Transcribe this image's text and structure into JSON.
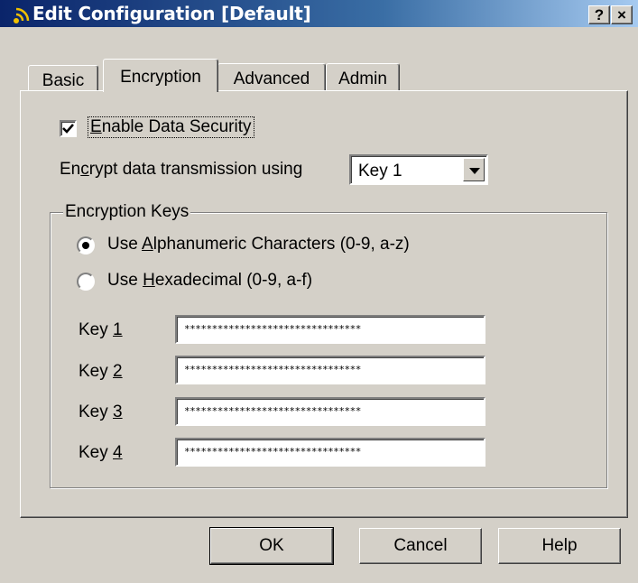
{
  "window": {
    "title": "Edit Configuration [Default]",
    "help_button": "?",
    "close_button": "×"
  },
  "tabs": [
    {
      "label": "Basic"
    },
    {
      "label": "Encryption"
    },
    {
      "label": "Advanced"
    },
    {
      "label": "Admin"
    }
  ],
  "active_tab": "Encryption",
  "enable_data_security": {
    "label_prefix": "",
    "label_accel": "E",
    "label_rest": "nable Data Security",
    "checked": true
  },
  "encrypt_using": {
    "label_prefix": "En",
    "label_accel": "c",
    "label_rest": "rypt data transmission using",
    "selected": "Key 1"
  },
  "encryption_keys": {
    "group_label": "Encryption Keys",
    "options": [
      {
        "prefix": "Use ",
        "accel": "A",
        "rest": "lphanumeric Characters (0-9, a-z)",
        "selected": true
      },
      {
        "prefix": "Use ",
        "accel": "H",
        "rest": "exadecimal (0-9, a-f)",
        "selected": false
      }
    ],
    "keys": [
      {
        "prefix": "Key ",
        "accel": "1",
        "value": "********************************"
      },
      {
        "prefix": "Key ",
        "accel": "2",
        "value": "********************************"
      },
      {
        "prefix": "Key ",
        "accel": "3",
        "value": "********************************"
      },
      {
        "prefix": "Key ",
        "accel": "4",
        "value": "********************************"
      }
    ]
  },
  "buttons": {
    "ok": "OK",
    "cancel": "Cancel",
    "help": "Help"
  },
  "colors": {
    "dialog_bg": "#d4d0c8",
    "title_bar_start": "#0a246a",
    "title_bar_end": "#a6caf0"
  }
}
